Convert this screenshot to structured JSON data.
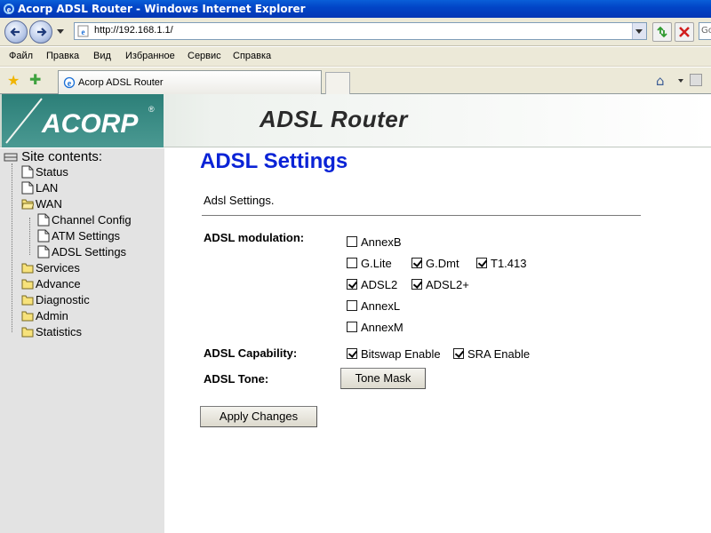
{
  "window": {
    "title": "Acorp ADSL Router - Windows Internet Explorer"
  },
  "address_bar": {
    "url": "http://192.168.1.1/",
    "search_hint": "Go"
  },
  "menu": {
    "items": [
      "Файл",
      "Правка",
      "Вид",
      "Избранное",
      "Сервис",
      "Справка"
    ]
  },
  "tab": {
    "label": "Acorp ADSL Router"
  },
  "banner": {
    "logo_text": "ACORP",
    "title": "ADSL Router"
  },
  "sidebar": {
    "header": "Site contents:",
    "items": [
      {
        "label": "Status",
        "type": "page"
      },
      {
        "label": "LAN",
        "type": "page"
      },
      {
        "label": "WAN",
        "type": "folder-open"
      },
      {
        "label": "Channel Config",
        "type": "page"
      },
      {
        "label": "ATM Settings",
        "type": "page"
      },
      {
        "label": "ADSL Settings",
        "type": "page"
      },
      {
        "label": "Services",
        "type": "folder"
      },
      {
        "label": "Advance",
        "type": "folder"
      },
      {
        "label": "Diagnostic",
        "type": "folder"
      },
      {
        "label": "Admin",
        "type": "folder"
      },
      {
        "label": "Statistics",
        "type": "folder"
      }
    ]
  },
  "main": {
    "heading": "ADSL Settings",
    "subtext": "Adsl Settings.",
    "modulation_label": "ADSL modulation:",
    "modulation": [
      {
        "label": "AnnexB",
        "checked": false
      },
      {
        "label": "G.Lite",
        "checked": false
      },
      {
        "label": "G.Dmt",
        "checked": true
      },
      {
        "label": "T1.413",
        "checked": true
      },
      {
        "label": "ADSL2",
        "checked": true
      },
      {
        "label": "ADSL2+",
        "checked": true
      },
      {
        "label": "AnnexL",
        "checked": false
      },
      {
        "label": "AnnexM",
        "checked": false
      }
    ],
    "capability_label": "ADSL Capability:",
    "capability": [
      {
        "label": "Bitswap Enable",
        "checked": true
      },
      {
        "label": "SRA Enable",
        "checked": true
      }
    ],
    "tone_label": "ADSL Tone:",
    "tone_button": "Tone Mask",
    "apply_button": "Apply Changes"
  }
}
